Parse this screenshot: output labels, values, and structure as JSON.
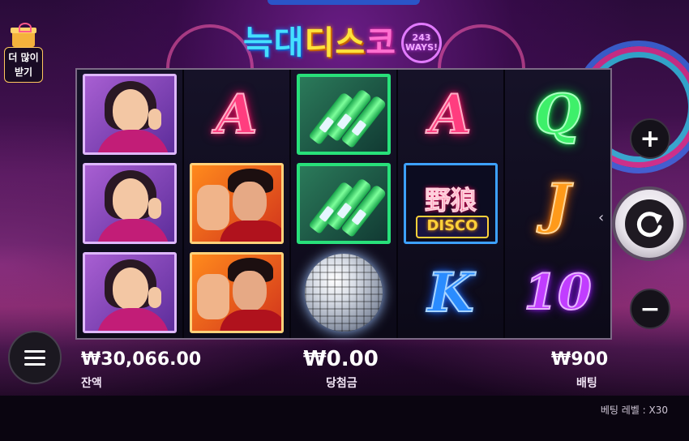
{
  "game": {
    "title_part1": "늑대",
    "title_part2": "디스",
    "title_part3": "코",
    "ways_number": "243",
    "ways_label": "WAYS!"
  },
  "promo": {
    "label_line1": "더 많이",
    "label_line2": "받기"
  },
  "reels": [
    [
      "woman",
      "woman",
      "woman"
    ],
    [
      "A",
      "man",
      "man"
    ],
    [
      "bottles",
      "bottles",
      "disco-ball"
    ],
    [
      "A",
      "wild-disco",
      "K"
    ],
    [
      "Q",
      "J",
      "10"
    ]
  ],
  "symbols": {
    "A": "A",
    "K": "K",
    "Q": "Q",
    "J": "J",
    "10": "10",
    "wild_zh": "野狼",
    "wild_en": "DISCO"
  },
  "hud": {
    "balance_value": "₩30,066.00",
    "balance_label": "잔액",
    "win_value": "₩0.00",
    "win_label": "당첨금",
    "bet_value": "₩900",
    "bet_label": "배팅",
    "bet_level": "베팅 레벨 : X30"
  },
  "controls": {
    "plus": "+",
    "minus": "−",
    "spin_symbol": "↻",
    "collapse_caret": "‹"
  }
}
